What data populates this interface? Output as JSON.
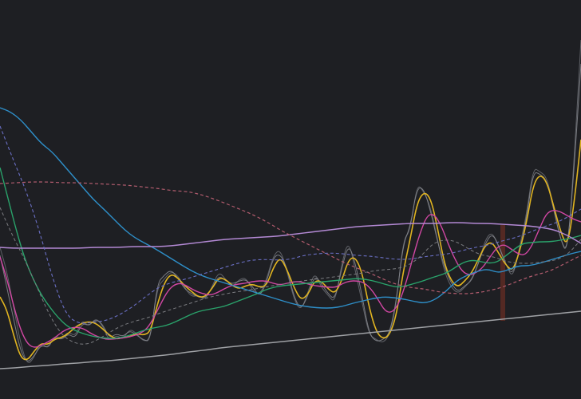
{
  "chart_data": {
    "type": "line",
    "grid": false,
    "legend": "none",
    "x": [
      0,
      1,
      2,
      3,
      4,
      5,
      6,
      7,
      8,
      9,
      10,
      11,
      12,
      13,
      14,
      15,
      16,
      17,
      18,
      19,
      20,
      21,
      22,
      23,
      24,
      25,
      26,
      27,
      28,
      29,
      30,
      31,
      32,
      33,
      34,
      35,
      36,
      37,
      38,
      39,
      40,
      41,
      42,
      43,
      44,
      45,
      46,
      47,
      48,
      49,
      50,
      51,
      52,
      53,
      54,
      55,
      56,
      57,
      58,
      59,
      60,
      61,
      62,
      63,
      64,
      65,
      66,
      67,
      68,
      69,
      70,
      71,
      72,
      73,
      74,
      75,
      76,
      77,
      78,
      79,
      80,
      81,
      82,
      83,
      84,
      85,
      86,
      87,
      88,
      89,
      90,
      91,
      92
    ],
    "xlim": [
      0,
      92
    ],
    "ylim": [
      0,
      500
    ],
    "series": [
      {
        "style": "raw",
        "color": "#6b6d73",
        "dash": "",
        "values": [
          310,
          340,
          385,
          430,
          458,
          448,
          428,
          438,
          420,
          425,
          415,
          422,
          400,
          410,
          398,
          408,
          428,
          420,
          425,
          412,
          418,
          428,
          425,
          360,
          350,
          340,
          345,
          360,
          372,
          370,
          376,
          360,
          340,
          350,
          360,
          350,
          348,
          365,
          370,
          350,
          320,
          312,
          340,
          375,
          390,
          368,
          340,
          360,
          370,
          380,
          330,
          300,
          340,
          380,
          420,
          425,
          430,
          420,
          380,
          300,
          290,
          230,
          240,
          260,
          300,
          340,
          360,
          368,
          360,
          350,
          330,
          300,
          290,
          310,
          330,
          350,
          310,
          270,
          210,
          215,
          222,
          260,
          300,
          320,
          200,
          50
        ]
      },
      {
        "style": "raw2",
        "color": "#8a8c92",
        "dash": "",
        "values": [
          320,
          360,
          400,
          440,
          455,
          446,
          432,
          436,
          422,
          426,
          418,
          424,
          405,
          408,
          400,
          406,
          424,
          418,
          422,
          414,
          420,
          426,
          428,
          355,
          345,
          338,
          348,
          362,
          368,
          372,
          374,
          362,
          345,
          352,
          356,
          352,
          350,
          360,
          372,
          354,
          322,
          318,
          336,
          372,
          388,
          372,
          345,
          355,
          368,
          376,
          336,
          305,
          330,
          372,
          418,
          428,
          426,
          418,
          376,
          305,
          285,
          235,
          236,
          265,
          302,
          334,
          355,
          366,
          358,
          352,
          330,
          305,
          292,
          308,
          332,
          345,
          315,
          275,
          215,
          218,
          226,
          262,
          300,
          318,
          210,
          80
        ]
      },
      {
        "style": "main",
        "color": "#e0b421",
        "dash": "",
        "values": [
          372,
          388,
          420,
          448,
          452,
          440,
          430,
          432,
          425,
          423,
          418,
          410,
          405,
          403,
          405,
          412,
          420,
          425,
          423,
          422,
          418,
          420,
          416,
          382,
          355,
          343,
          348,
          358,
          365,
          372,
          372,
          362,
          348,
          350,
          358,
          362,
          358,
          356,
          360,
          358,
          335,
          322,
          338,
          360,
          376,
          370,
          352,
          352,
          362,
          368,
          352,
          325,
          322,
          342,
          385,
          415,
          425,
          420,
          395,
          340,
          300,
          255,
          240,
          248,
          285,
          330,
          352,
          360,
          352,
          342,
          325,
          307,
          303,
          318,
          332,
          340,
          316,
          280,
          232,
          218,
          228,
          258,
          290,
          310,
          255,
          175
        ]
      },
      {
        "style": "ma-short",
        "color": "#d147a3",
        "dash": "",
        "values": [
          322,
          350,
          385,
          415,
          432,
          436,
          432,
          428,
          422,
          415,
          411,
          410,
          412,
          418,
          422,
          425,
          425,
          424,
          423,
          421,
          418,
          412,
          398,
          380,
          364,
          356,
          355,
          360,
          365,
          368,
          370,
          367,
          362,
          358,
          356,
          355,
          353,
          352,
          352,
          355,
          357,
          355,
          353,
          353,
          356,
          358,
          359,
          360,
          360,
          355,
          352,
          352,
          354,
          362,
          375,
          390,
          392,
          380,
          355,
          322,
          292,
          270,
          268,
          282,
          305,
          325,
          340,
          345,
          342,
          335,
          322,
          310,
          306,
          312,
          318,
          320,
          308,
          288,
          268,
          263,
          265,
          270,
          275,
          278
        ]
      },
      {
        "style": "ma-mid",
        "color": "#2aa36b",
        "dash": "",
        "values": [
          210,
          250,
          290,
          325,
          350,
          370,
          385,
          398,
          408,
          414,
          418,
          421,
          423,
          424,
          424,
          422,
          419,
          415,
          412,
          410,
          408,
          404,
          399,
          394,
          390,
          388,
          386,
          384,
          380,
          376,
          372,
          368,
          363,
          360,
          358,
          357,
          356,
          355,
          354,
          353,
          352,
          351,
          350,
          349,
          350,
          352,
          355,
          358,
          360,
          358,
          355,
          352,
          348,
          345,
          341,
          334,
          328,
          326,
          328,
          330,
          328,
          320,
          312,
          305,
          304,
          303,
          303,
          302,
          300,
          298,
          295
        ]
      },
      {
        "style": "ma-long",
        "color": "#2e8fc9",
        "dash": "",
        "values": [
          135,
          140,
          150,
          165,
          180,
          190,
          205,
          220,
          235,
          250,
          262,
          275,
          288,
          298,
          305,
          312,
          320,
          328,
          336,
          343,
          348,
          352,
          356,
          360,
          364,
          368,
          372,
          376,
          380,
          383,
          385,
          386,
          386,
          384,
          380,
          377,
          374,
          372,
          373,
          375,
          378,
          380,
          375,
          365,
          352,
          345,
          340,
          337,
          342,
          338,
          333,
          333,
          330,
          326,
          322,
          318,
          315
        ]
      },
      {
        "style": "ma-very-long",
        "color": "#b389d4",
        "dash": "",
        "values": [
          310,
          311,
          311,
          311,
          311,
          311,
          311,
          310,
          310,
          310,
          309,
          309,
          309,
          308,
          306,
          304,
          302,
          300,
          299,
          298,
          297,
          296,
          294,
          292,
          290,
          288,
          286,
          284,
          283,
          282,
          281,
          280,
          280,
          280,
          279,
          279,
          280,
          280,
          281,
          282,
          283,
          285,
          288,
          295,
          305
        ]
      },
      {
        "style": "ma-dashed-red",
        "color": "#b25c6e",
        "dash": "4 3",
        "values": [
          230,
          229,
          228,
          228,
          229,
          229,
          230,
          231,
          232,
          234,
          236,
          239,
          240,
          245,
          252,
          260,
          268,
          278,
          290,
          300,
          310,
          320,
          330,
          338,
          346,
          355,
          360,
          362,
          366,
          368,
          368,
          365,
          360,
          352,
          345,
          340,
          330,
          320
        ]
      },
      {
        "style": "ma-dashed-purple",
        "color": "#6a6fc4",
        "dash": "4 3",
        "values": [
          158,
          200,
          240,
          290,
          350,
          395,
          406,
          404,
          402,
          395,
          385,
          372,
          360,
          354,
          350,
          345,
          340,
          335,
          330,
          326,
          325,
          326,
          325,
          320,
          318,
          317,
          318,
          320,
          321,
          323,
          325,
          325,
          322,
          320,
          318,
          314,
          310,
          307,
          302,
          298,
          292,
          285,
          280,
          272,
          262
        ]
      },
      {
        "style": "ma-dashed-gray",
        "color": "#7b7c80",
        "dash": "4 3",
        "values": [
          260,
          295,
          325,
          360,
          395,
          420,
          430,
          432,
          425,
          415,
          407,
          402,
          398,
          392,
          387,
          382,
          377,
          372,
          369,
          366,
          364,
          361,
          358,
          356,
          353,
          351,
          349,
          347,
          345,
          343,
          340,
          338,
          337,
          333,
          322,
          305,
          300,
          303,
          313,
          320,
          322,
          328,
          330,
          330,
          328,
          326,
          318,
          300
        ]
      },
      {
        "style": "baseline",
        "color": "#9fa1a5",
        "dash": "",
        "values": [
          462,
          461,
          459,
          458,
          456,
          455,
          453,
          452,
          450,
          448,
          446,
          444,
          441,
          439,
          436,
          434,
          432,
          430,
          428,
          426,
          424,
          422,
          420,
          418,
          416,
          414,
          412,
          410,
          408,
          406,
          404,
          402,
          400,
          398,
          396,
          394,
          392,
          390
        ]
      }
    ],
    "annotations": [
      {
        "kind": "highlight-bar",
        "color": "#6b2e23",
        "x": 630,
        "y_top": 282,
        "y_bottom": 402
      }
    ]
  }
}
